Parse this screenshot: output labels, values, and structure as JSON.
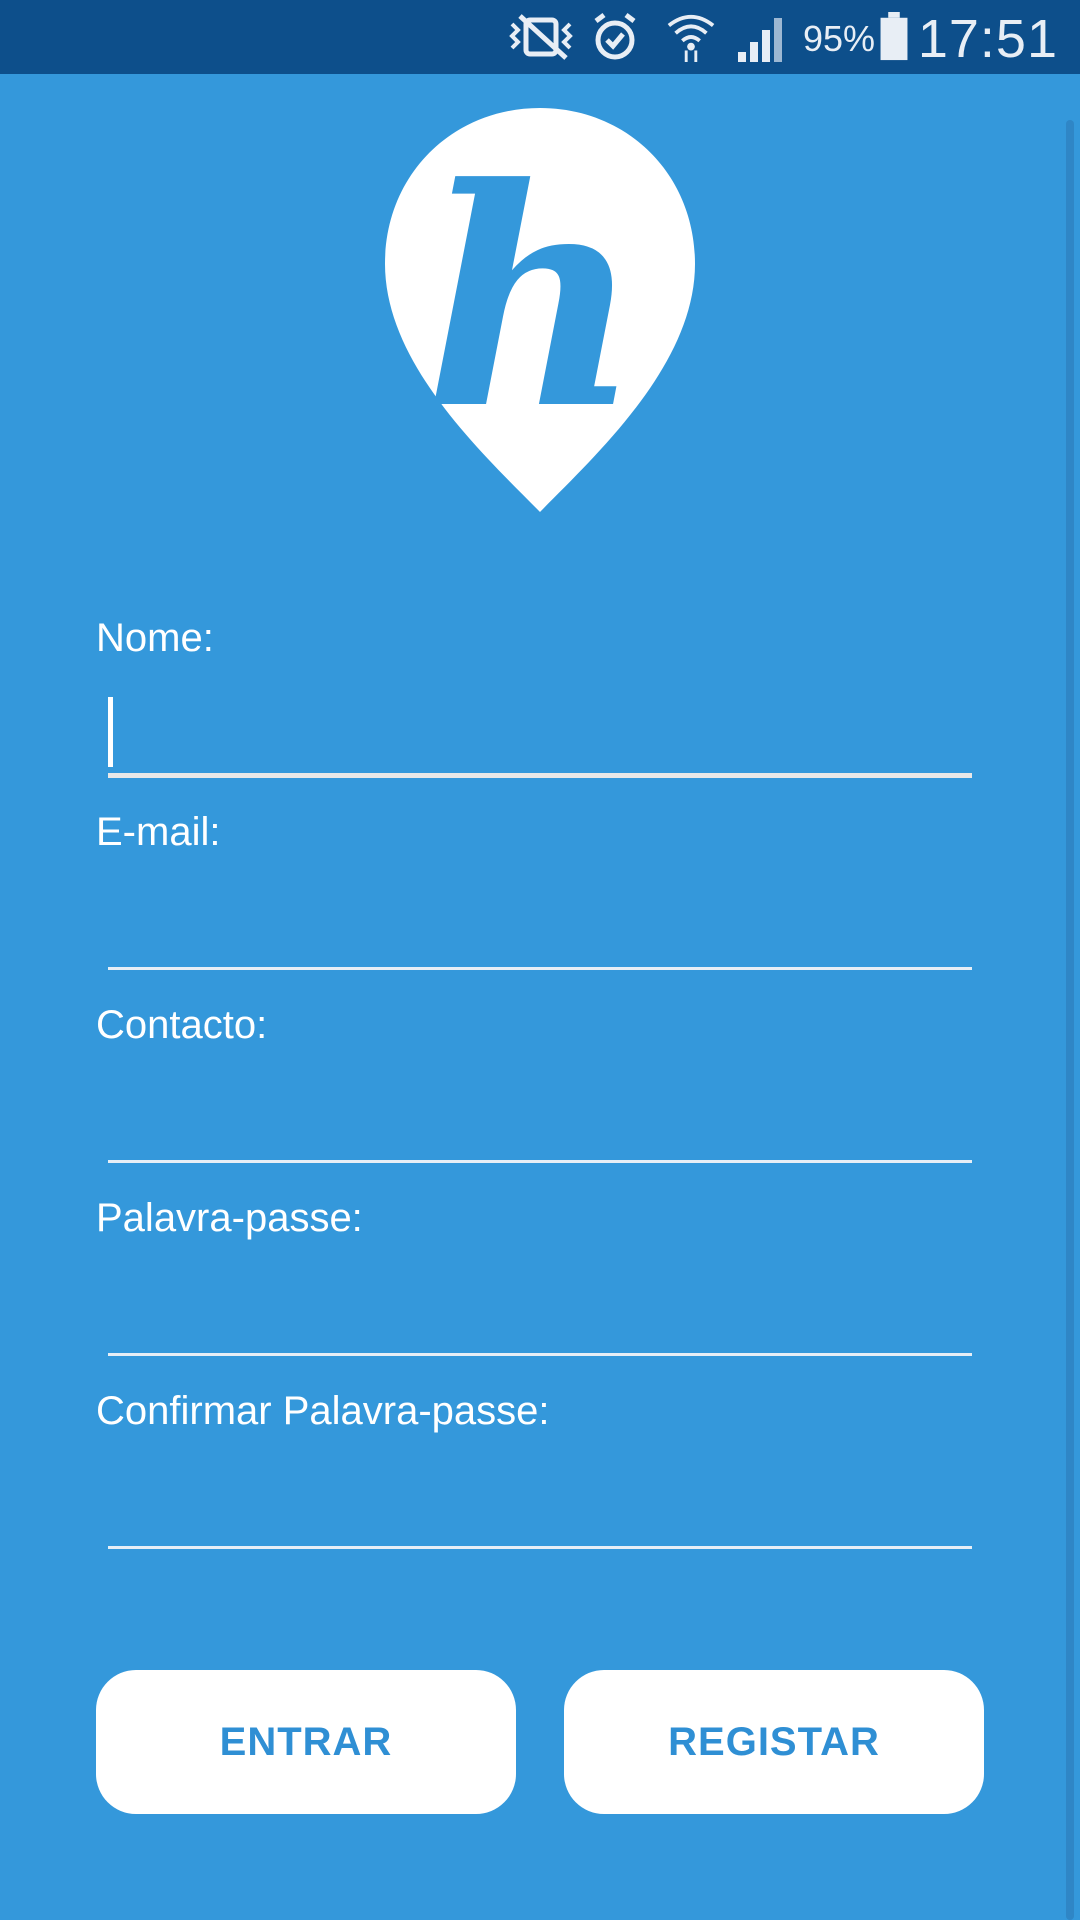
{
  "status_bar": {
    "icons": [
      "vibrate-muted-icon",
      "alarm-icon",
      "wifi-icon",
      "signal-icon",
      "battery-icon"
    ],
    "battery_percent": "95%",
    "time": "17:51"
  },
  "logo": {
    "letter": "h",
    "icon": "map-pin-logo-icon"
  },
  "form": {
    "name_label": "Nome:",
    "email_label": "E-mail:",
    "contact_label": "Contacto:",
    "password_label": "Palavra-passe:",
    "confirm_password_label": "Confirmar Palavra-passe:",
    "name_value": "",
    "email_value": "",
    "contact_value": "",
    "password_value": "",
    "confirm_password_value": ""
  },
  "buttons": {
    "login_label": "ENTRAR",
    "register_label": "REGISTAR"
  },
  "colors": {
    "background": "#3498db",
    "status_bar": "#0d4f8b",
    "button_text": "#2f8fd4",
    "button_bg": "#ffffff"
  }
}
